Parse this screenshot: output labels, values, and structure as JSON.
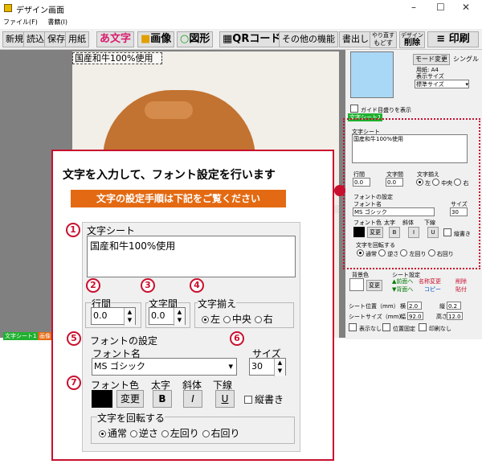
{
  "window": {
    "title": "デザイン画面",
    "min": "–",
    "max": "☐",
    "close": "✕"
  },
  "menu": [
    "ファイル(F)",
    "書籍(I)"
  ],
  "toolbar": {
    "new": "新規",
    "read": "読込",
    "save": "保存",
    "paper": "用紙",
    "text": "あ文字",
    "image": "画像",
    "shape": "図形",
    "qr": "QRコード",
    "other": "その他の機能",
    "write": "書出し",
    "redo_top": "やり直す",
    "redo_bottom": "もどす",
    "delete_top": "デザイン",
    "delete_bottom": "削除",
    "print": "印刷"
  },
  "canvas": {
    "selected_text": "国産和牛100%使用",
    "tab1": "文字シート1",
    "tab2": "画像"
  },
  "right": {
    "mode_button": "モード変更",
    "mode_value": "シングル",
    "paper": "用紙: A4",
    "display_size_label": "表示サイズ",
    "display_size_value": "標準サイズ",
    "guide": "ガイド目盛りを表示",
    "tab": "文字シート1",
    "sheet_label": "文字シート",
    "sheet_text": "国産和牛100%使用",
    "line_spacing": "行間",
    "char_spacing": "文字間",
    "align": "文字揃え",
    "line_val": "0.0",
    "char_val": "0.0",
    "align_left": "左",
    "align_center": "中央",
    "align_right": "右",
    "font_settings": "フォントの設定",
    "font_name": "フォント名",
    "size": "サイズ",
    "font_value": "MS ゴシック",
    "size_value": "30",
    "font_color": "フォント色",
    "bold": "太字",
    "italic": "斜体",
    "underline": "下線",
    "change": "変更",
    "vertical": "縦書き",
    "rotate": "文字を回転する",
    "rot_normal": "通常",
    "rot_reverse": "逆さ",
    "rot_left": "左回り",
    "rot_right": "右回り",
    "bg_color": "背景色",
    "bg_change": "変更",
    "sheet_settings": "シート設定",
    "front": "▲前面へ",
    "back": "▼背面へ",
    "name_change": "名称変更",
    "copy": "コピー",
    "delete": "削除",
    "paste": "貼付",
    "pos_label": "シート位置（mm）",
    "size_label": "シートサイズ（mm）",
    "x_label": "横",
    "y_label": "縦",
    "w_label": "幅",
    "h_label": "高さ",
    "x": "2.0",
    "y": "0.2",
    "w": "92.0",
    "h": "12.0",
    "hide": "表示なし",
    "lock": "位置固定",
    "noprint": "印刷なし"
  },
  "callout": {
    "title": "文字を入力して、フォント設定を行います",
    "subtitle": "文字の設定手順は下記をご覧ください",
    "sheet_label": "文字シート",
    "text": "国産和牛100%使用",
    "line_spacing": "行間",
    "char_spacing": "文字間",
    "align": "文字揃え",
    "line_val": "0.0",
    "char_val": "0.0",
    "align_left": "左",
    "align_center": "中央",
    "align_right": "右",
    "font_settings": "フォントの設定",
    "font_name": "フォント名",
    "size": "サイズ",
    "font_value": "MS ゴシック",
    "size_value": "30",
    "font_color": "フォント色",
    "bold_label": "太字",
    "italic_label": "斜体",
    "underline_label": "下線",
    "change": "変更",
    "bold": "B",
    "italic": "I",
    "underline": "U",
    "vertical": "縦書き",
    "rotate": "文字を回転する",
    "rot_normal": "通常",
    "rot_reverse": "逆さ",
    "rot_left": "左回り",
    "rot_right": "右回り",
    "steps": [
      "1",
      "2",
      "3",
      "4",
      "5",
      "6",
      "7"
    ]
  },
  "colors": {
    "accent": "#c8102e",
    "orange": "#e36a12",
    "preview": "#a9d8f6"
  }
}
